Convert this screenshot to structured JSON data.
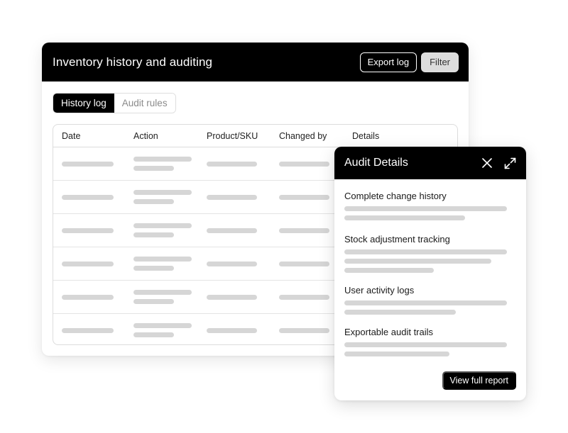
{
  "main": {
    "title": "Inventory history and auditing",
    "export_label": "Export log",
    "filter_label": "Filter",
    "tabs": [
      {
        "label": "History log",
        "active": true
      },
      {
        "label": "Audit rules",
        "active": false
      }
    ],
    "table": {
      "columns": [
        "Date",
        "Action",
        "Product/SKU",
        "Changed by",
        "Details"
      ],
      "row_count": 6
    }
  },
  "panel": {
    "title": "Audit Details",
    "icons": [
      "close-icon",
      "expand-icon"
    ],
    "sections": [
      {
        "title": "Complete change history"
      },
      {
        "title": "Stock adjustment tracking"
      },
      {
        "title": "User activity logs"
      },
      {
        "title": "Exportable audit trails"
      }
    ],
    "report_button": "View full report"
  },
  "colors": {
    "header_bg": "#000000",
    "skeleton": "#d6d6d6",
    "border": "#dcdcdc"
  }
}
